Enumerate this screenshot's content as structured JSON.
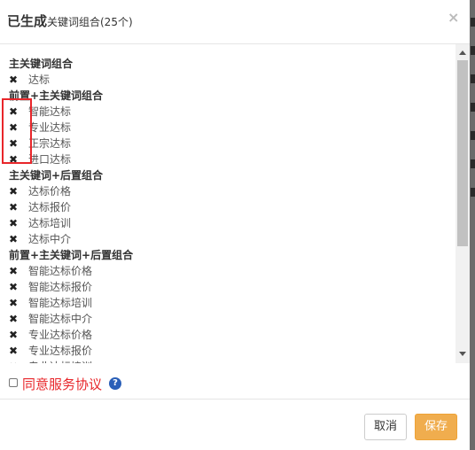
{
  "header": {
    "title": "已生成",
    "subtitle": "关键词组合(25个)",
    "close_glyph": "×"
  },
  "keyword_list": [
    {
      "kind": "heading",
      "text": "主关键词组合"
    },
    {
      "kind": "item",
      "text": "达标"
    },
    {
      "kind": "heading",
      "text": "前置+主关键词组合"
    },
    {
      "kind": "item",
      "text": "智能达标"
    },
    {
      "kind": "item",
      "text": "专业达标"
    },
    {
      "kind": "item",
      "text": "正宗达标"
    },
    {
      "kind": "item",
      "text": "进口达标"
    },
    {
      "kind": "heading",
      "text": "主关键词+后置组合"
    },
    {
      "kind": "item",
      "text": "达标价格"
    },
    {
      "kind": "item",
      "text": "达标报价"
    },
    {
      "kind": "item",
      "text": "达标培训"
    },
    {
      "kind": "item",
      "text": "达标中介"
    },
    {
      "kind": "heading",
      "text": "前置+主关键词+后置组合"
    },
    {
      "kind": "item",
      "text": "智能达标价格"
    },
    {
      "kind": "item",
      "text": "智能达标报价"
    },
    {
      "kind": "item",
      "text": "智能达标培训"
    },
    {
      "kind": "item",
      "text": "智能达标中介"
    },
    {
      "kind": "item",
      "text": "专业达标价格"
    },
    {
      "kind": "item",
      "text": "专业达标报价"
    },
    {
      "kind": "item",
      "text": "专业达标培训"
    }
  ],
  "remove_glyph": "✖",
  "agreement": {
    "checked": false,
    "label": "同意服务协议",
    "help_icon": "question-circle-icon"
  },
  "footer": {
    "cancel_label": "取消",
    "save_label": "保存"
  },
  "colors": {
    "agreement_red": "#e8262a",
    "save_orange": "#f0ad4e",
    "highlight_red": "#e8262a",
    "help_blue": "#2a5fb8"
  }
}
